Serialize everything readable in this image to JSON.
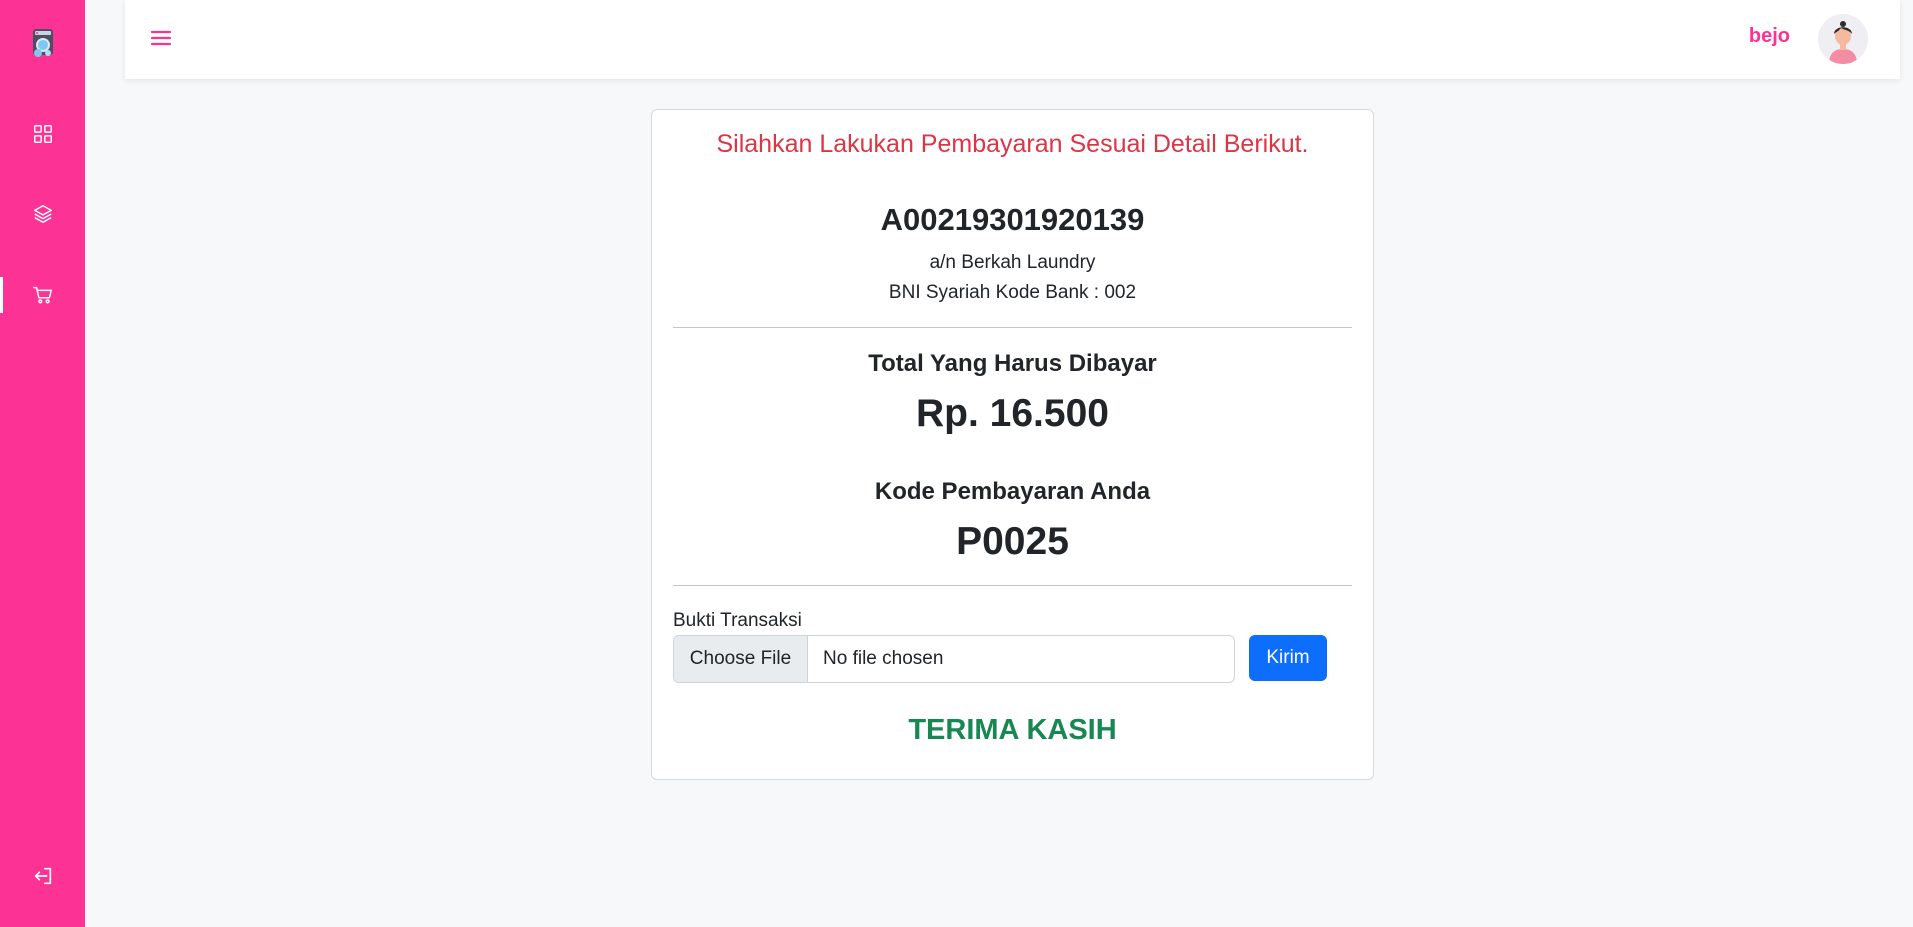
{
  "colors": {
    "brand": "#fc3394",
    "danger": "#dc3545",
    "success": "#198754",
    "primary": "#0d6efd"
  },
  "sidebar": {
    "logo_icon": "laundry-machine-logo",
    "items": [
      {
        "icon": "grid-icon",
        "active": false
      },
      {
        "icon": "layers-icon",
        "active": false
      },
      {
        "icon": "cart-icon",
        "active": true
      }
    ],
    "logout_icon": "logout-icon"
  },
  "header": {
    "menu_icon": "hamburger-icon",
    "username": "bejo",
    "avatar_icon": "user-avatar"
  },
  "payment": {
    "headline": "Silahkan Lakukan Pembayaran Sesuai Detail Berikut.",
    "account_number": "A00219301920139",
    "account_name": "a/n Berkah Laundry",
    "bank": "BNI Syariah Kode Bank : 002",
    "total_label": "Total Yang Harus Dibayar",
    "total_value": "Rp. 16.500",
    "code_label": "Kode Pembayaran Anda",
    "code_value": "P0025",
    "upload_label": "Bukti Transaksi",
    "choose_file": "Choose File",
    "file_status": "No file chosen",
    "submit_label": "Kirim",
    "thanks": "TERIMA KASIH"
  }
}
